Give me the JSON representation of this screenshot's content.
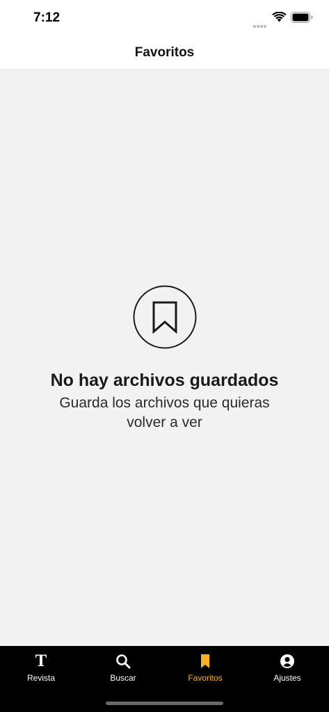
{
  "status_bar": {
    "time": "7:12"
  },
  "header": {
    "title": "Favoritos"
  },
  "empty_state": {
    "icon": "bookmark-icon",
    "title": "No hay archivos guardados",
    "subtitle": "Guarda los archivos que quieras volver a ver"
  },
  "tab_bar": {
    "active_color": "#f5b320",
    "tabs": [
      {
        "label": "Revista",
        "icon": "revista-t-icon",
        "active": false
      },
      {
        "label": "Buscar",
        "icon": "search-icon",
        "active": false
      },
      {
        "label": "Favoritos",
        "icon": "bookmark-icon",
        "active": true
      },
      {
        "label": "Ajustes",
        "icon": "profile-icon",
        "active": false
      }
    ]
  }
}
